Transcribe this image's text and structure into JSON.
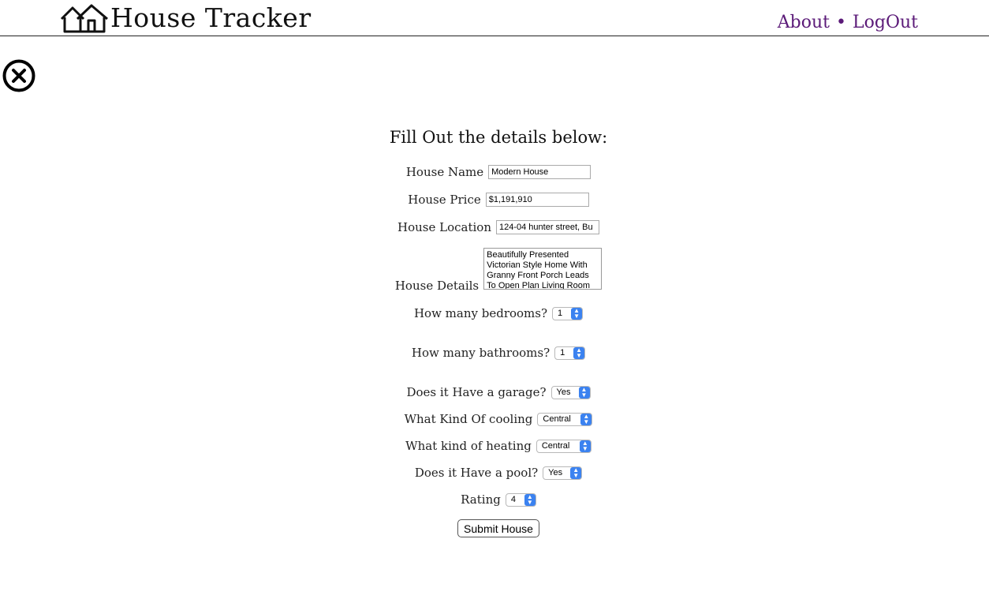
{
  "header": {
    "title": "House Tracker",
    "nav": {
      "about": "About",
      "separator": "•",
      "logout": "LogOut"
    }
  },
  "form": {
    "title": "Fill Out the details below:",
    "house_name": {
      "label": "House Name",
      "value": "Modern House"
    },
    "house_price": {
      "label": "House Price",
      "value": "$1,191,910"
    },
    "house_location": {
      "label": "House Location",
      "value": "124-04 hunter street, Bu"
    },
    "house_details": {
      "label": "House Details",
      "value": "Beautifully Presented Victorian Style Home With Granny Front Porch Leads To Open Plan Living Room"
    },
    "bedrooms": {
      "label": "How many bedrooms?",
      "value": "1"
    },
    "bathrooms": {
      "label": "How many bathrooms?",
      "value": "1"
    },
    "garage": {
      "label": "Does it Have a garage?",
      "value": "Yes"
    },
    "cooling": {
      "label": "What Kind Of cooling",
      "value": "Central"
    },
    "heating": {
      "label": "What kind of heating",
      "value": "Central"
    },
    "pool": {
      "label": "Does it Have a pool?",
      "value": "Yes"
    },
    "rating": {
      "label": "Rating",
      "value": "4"
    },
    "submit_label": "Submit House"
  },
  "icons": {
    "logo": "house-logo-icon",
    "close": "close-circle-icon",
    "select_arrow": "chevron-updown-icon"
  },
  "colors": {
    "nav_link": "#5b1a78",
    "select_arrow": "#3b82f0"
  }
}
